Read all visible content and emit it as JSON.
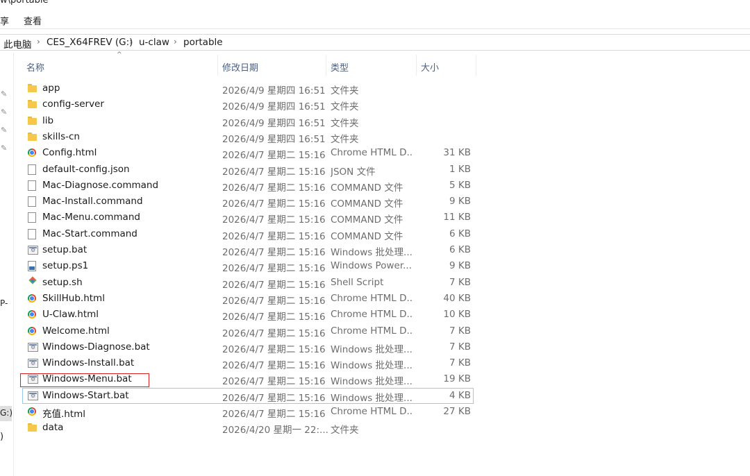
{
  "window": {
    "title_fragment": "w\\portable"
  },
  "ribbon": {
    "tab_left_fragment": "享",
    "tab_view": "查看"
  },
  "breadcrumb": {
    "items": [
      "此电脑",
      "CES_X64FREV (G:)",
      "u-claw",
      "portable"
    ]
  },
  "nav_pane": {
    "fragment_p": "P-",
    "fragment_drive": "G:)",
    "fragment_paren": ")"
  },
  "columns": {
    "name": "名称",
    "date": "修改日期",
    "type": "类型",
    "size": "大小"
  },
  "files": [
    {
      "name": "app",
      "date": "2026/4/9 星期四 16:51",
      "type": "文件夹",
      "size": "",
      "icon": "folder-icon"
    },
    {
      "name": "config-server",
      "date": "2026/4/9 星期四 16:51",
      "type": "文件夹",
      "size": "",
      "icon": "folder-icon"
    },
    {
      "name": "lib",
      "date": "2026/4/9 星期四 16:51",
      "type": "文件夹",
      "size": "",
      "icon": "folder-icon"
    },
    {
      "name": "skills-cn",
      "date": "2026/4/9 星期四 16:51",
      "type": "文件夹",
      "size": "",
      "icon": "folder-icon"
    },
    {
      "name": "Config.html",
      "date": "2026/4/7 星期二 15:16",
      "type": "Chrome HTML D...",
      "size": "31 KB",
      "icon": "chrome-icon"
    },
    {
      "name": "default-config.json",
      "date": "2026/4/7 星期二 15:16",
      "type": "JSON 文件",
      "size": "1 KB",
      "icon": "document-icon"
    },
    {
      "name": "Mac-Diagnose.command",
      "date": "2026/4/7 星期二 15:16",
      "type": "COMMAND 文件",
      "size": "5 KB",
      "icon": "document-icon"
    },
    {
      "name": "Mac-Install.command",
      "date": "2026/4/7 星期二 15:16",
      "type": "COMMAND 文件",
      "size": "9 KB",
      "icon": "document-icon"
    },
    {
      "name": "Mac-Menu.command",
      "date": "2026/4/7 星期二 15:16",
      "type": "COMMAND 文件",
      "size": "11 KB",
      "icon": "document-icon"
    },
    {
      "name": "Mac-Start.command",
      "date": "2026/4/7 星期二 15:16",
      "type": "COMMAND 文件",
      "size": "6 KB",
      "icon": "document-icon"
    },
    {
      "name": "setup.bat",
      "date": "2026/4/7 星期二 15:16",
      "type": "Windows 批处理...",
      "size": "6 KB",
      "icon": "batch-file-icon"
    },
    {
      "name": "setup.ps1",
      "date": "2026/4/7 星期二 15:16",
      "type": "Windows Power...",
      "size": "9 KB",
      "icon": "powershell-icon"
    },
    {
      "name": "setup.sh",
      "date": "2026/4/7 星期二 15:16",
      "type": "Shell Script",
      "size": "7 KB",
      "icon": "shell-script-icon"
    },
    {
      "name": "SkillHub.html",
      "date": "2026/4/7 星期二 15:16",
      "type": "Chrome HTML D...",
      "size": "40 KB",
      "icon": "chrome-icon"
    },
    {
      "name": "U-Claw.html",
      "date": "2026/4/7 星期二 15:16",
      "type": "Chrome HTML D...",
      "size": "10 KB",
      "icon": "chrome-icon"
    },
    {
      "name": "Welcome.html",
      "date": "2026/4/7 星期二 15:16",
      "type": "Chrome HTML D...",
      "size": "7 KB",
      "icon": "chrome-icon"
    },
    {
      "name": "Windows-Diagnose.bat",
      "date": "2026/4/7 星期二 15:16",
      "type": "Windows 批处理...",
      "size": "7 KB",
      "icon": "batch-file-icon"
    },
    {
      "name": "Windows-Install.bat",
      "date": "2026/4/7 星期二 15:16",
      "type": "Windows 批处理...",
      "size": "7 KB",
      "icon": "batch-file-icon"
    },
    {
      "name": "Windows-Menu.bat",
      "date": "2026/4/7 星期二 15:16",
      "type": "Windows 批处理...",
      "size": "19 KB",
      "icon": "batch-file-icon",
      "highlighted": true
    },
    {
      "name": "Windows-Start.bat",
      "date": "2026/4/7 星期二 15:16",
      "type": "Windows 批处理...",
      "size": "4 KB",
      "icon": "batch-file-icon",
      "focused": true
    },
    {
      "name": "充值.html",
      "date": "2026/4/7 星期二 15:16",
      "type": "Chrome HTML D...",
      "size": "27 KB",
      "icon": "chrome-icon"
    },
    {
      "name": "data",
      "date": "2026/4/20 星期一 22:...",
      "type": "文件夹",
      "size": "",
      "icon": "folder-icon"
    }
  ],
  "colors": {
    "highlight_border": "#d8201f",
    "focus_outline": "#99c9ef",
    "header_text": "#4d6082",
    "folder": "#f5c84b"
  }
}
